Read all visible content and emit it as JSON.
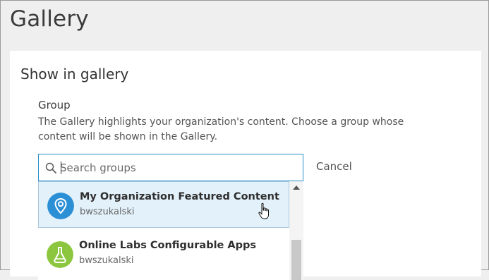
{
  "page": {
    "title": "Gallery"
  },
  "section": {
    "title": "Show in gallery",
    "group_label": "Group",
    "description": "The Gallery highlights your organization's content. Choose a group whose content will be shown in the Gallery."
  },
  "search": {
    "placeholder": "Search groups",
    "value": "",
    "icon": "search-icon",
    "cancel_label": "Cancel"
  },
  "results": [
    {
      "title": "My Organization Featured Content",
      "owner": "bwszukalski",
      "icon": "location-pin-icon",
      "icon_color": "#2b8fd6",
      "selected": true
    },
    {
      "title": "Online Labs Configurable Apps",
      "owner": "bwszukalski",
      "icon": "flask-icon",
      "icon_color": "#8cc63f",
      "selected": false
    }
  ],
  "colors": {
    "accent": "#2a8fc9",
    "selected_row": "#e3f1fa"
  }
}
